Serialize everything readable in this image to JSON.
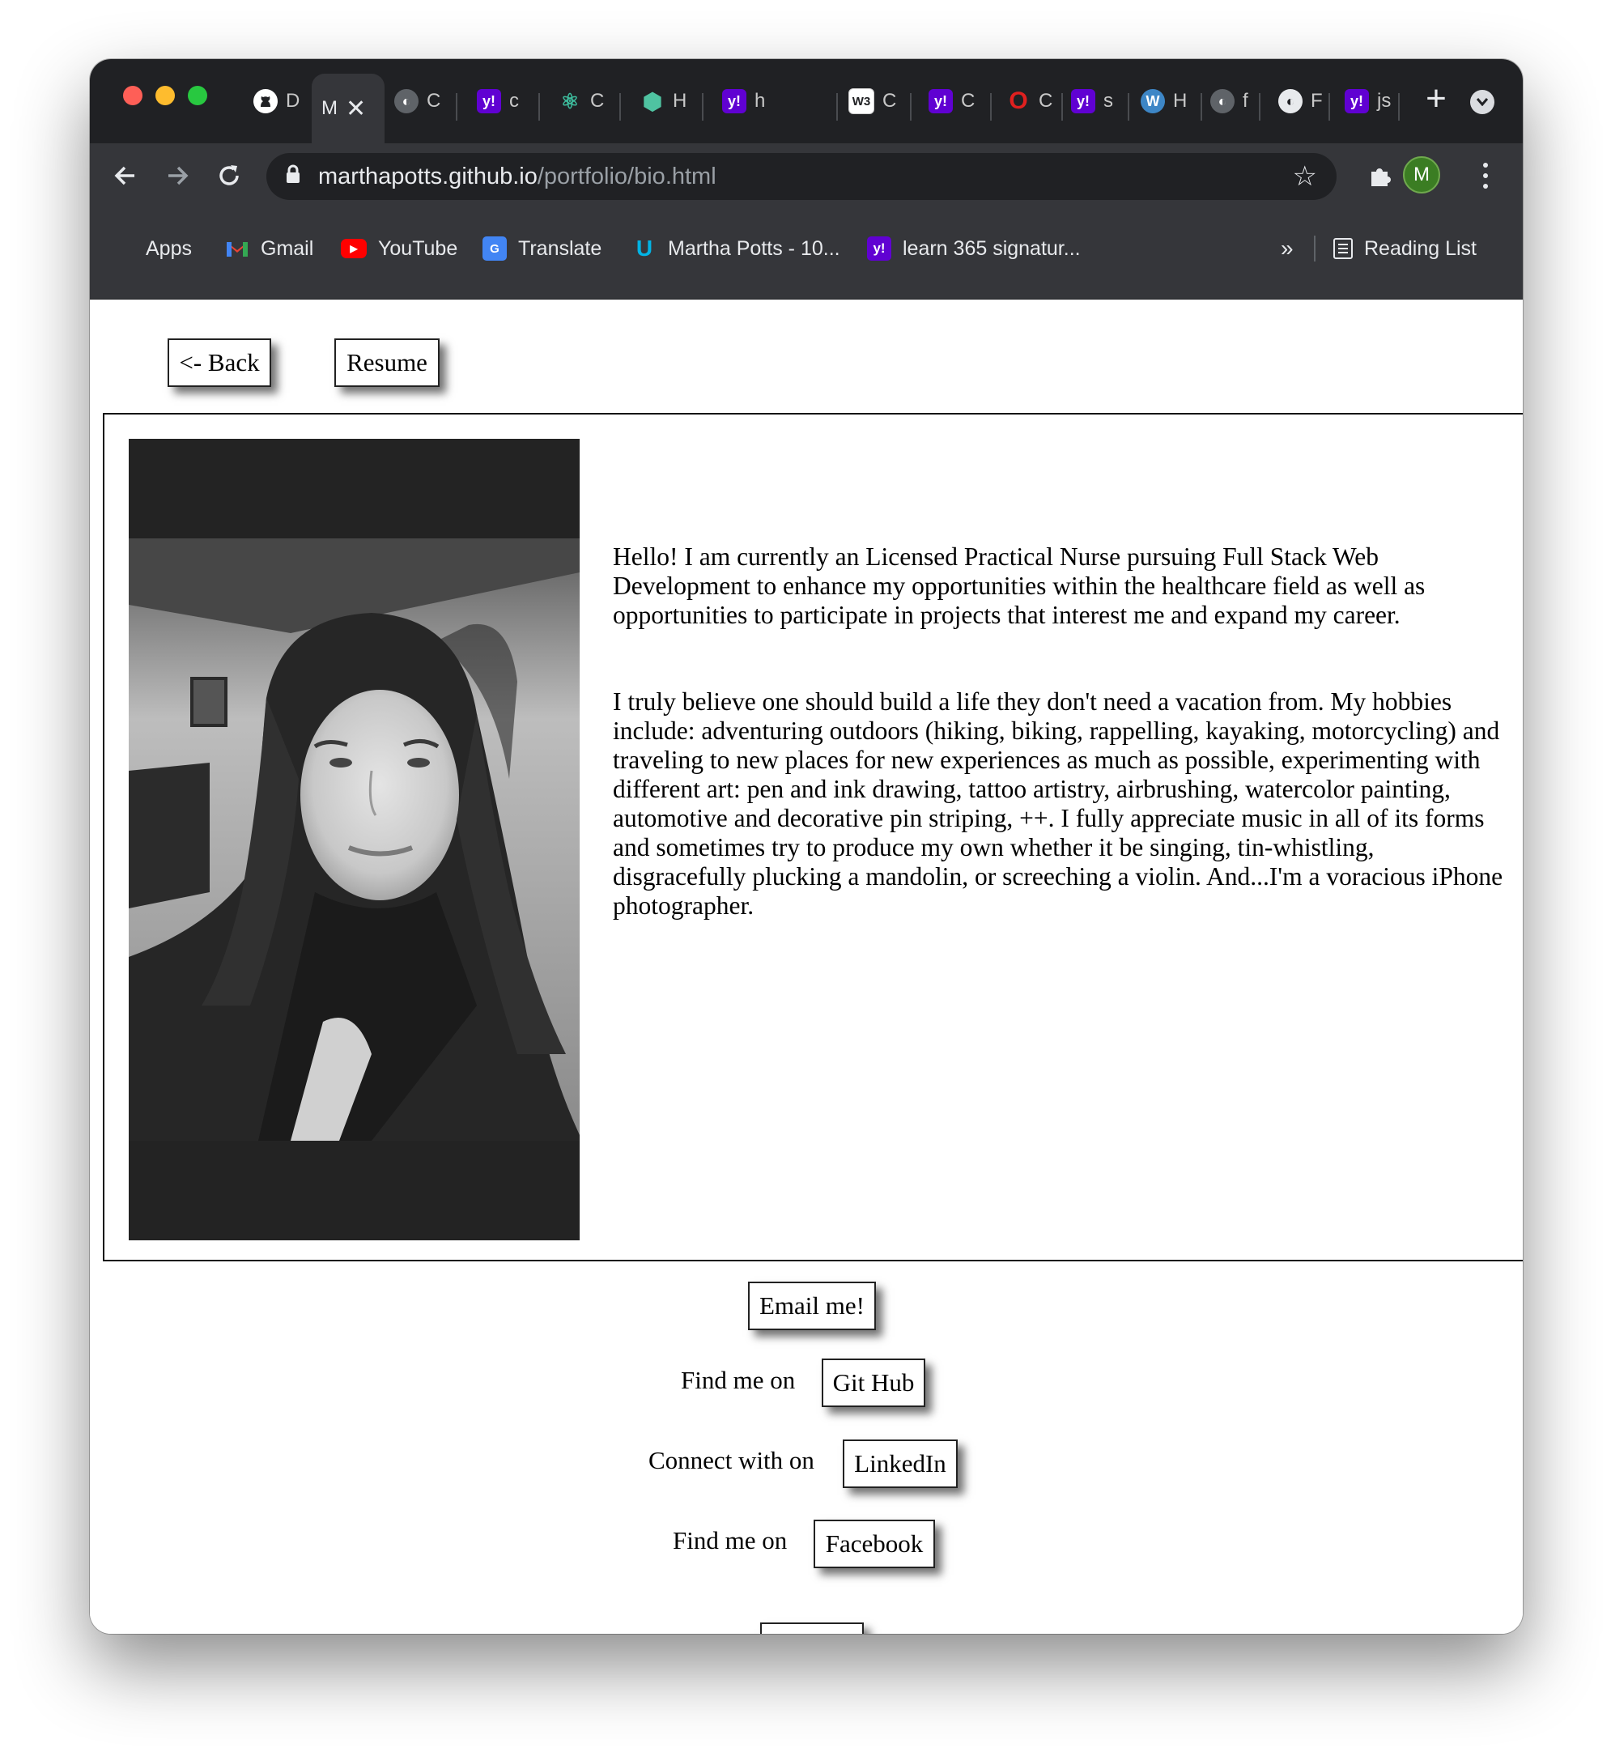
{
  "browser": {
    "active_tab_label": "M",
    "tabs": [
      {
        "icon": "github-icon",
        "label": "D"
      },
      {
        "icon": "page-icon",
        "label": "M"
      },
      {
        "icon": "globe-icon",
        "label": "C"
      },
      {
        "icon": "yahoo-icon",
        "label": "c"
      },
      {
        "icon": "react-icon",
        "label": "C"
      },
      {
        "icon": "hex-icon",
        "label": "H"
      },
      {
        "icon": "yahoo-icon",
        "label": "h"
      },
      {
        "icon": "w3schools-icon",
        "label": "C"
      },
      {
        "icon": "yahoo-icon",
        "label": "C"
      },
      {
        "icon": "opera-icon",
        "label": "C"
      },
      {
        "icon": "yahoo-icon",
        "label": "s"
      },
      {
        "icon": "wordpress-icon",
        "label": "H"
      },
      {
        "icon": "globe-icon",
        "label": "f"
      },
      {
        "icon": "globe-icon",
        "label": "F"
      },
      {
        "icon": "yahoo-icon",
        "label": "js"
      }
    ],
    "url_host": "marthapotts.github.io",
    "url_path": "/portfolio/bio.html",
    "profile_initial": "M",
    "bookmarks": [
      {
        "icon": "apps-grid-icon",
        "label": "Apps"
      },
      {
        "icon": "gmail-icon",
        "label": "Gmail"
      },
      {
        "icon": "youtube-icon",
        "label": "YouTube"
      },
      {
        "icon": "translate-icon",
        "label": "Translate"
      },
      {
        "icon": "udacity-icon",
        "label": "Martha Potts - 10..."
      },
      {
        "icon": "yahoo-icon",
        "label": "learn 365 signatur..."
      }
    ],
    "overflow_label": "»",
    "reading_list_label": "Reading List"
  },
  "page": {
    "back_label": "<- Back",
    "resume_label": "Resume",
    "bio_paragraph_1": "Hello! I am currently an Licensed Practical Nurse pursuing Full Stack Web Development to enhance my opportunities within the healthcare field as well as opportunities to participate in projects that interest me and expand my career.",
    "bio_paragraph_2": "I truly believe one should build a life they don't need a vacation from. My hobbies include: adventuring outdoors (hiking, biking, rappelling, kayaking, motorcycling) and traveling to new places for new experiences as much as possible, experimenting with different art: pen and ink drawing, tattoo artistry, airbrushing, watercolor painting, automotive and decorative pin striping, ++. I fully appreciate music in all of its forms and sometimes try to produce my own whether it be singing, tin-whistling, disgracefully plucking a mandolin, or screeching a violin. And...I'm a voracious iPhone photographer.",
    "email_label": "Email me!",
    "github_prefix": "Find me on",
    "github_label": "Git Hub",
    "linkedin_prefix": "Connect with on",
    "linkedin_label": "LinkedIn",
    "facebook_prefix": "Find me on",
    "facebook_label": "Facebook"
  }
}
